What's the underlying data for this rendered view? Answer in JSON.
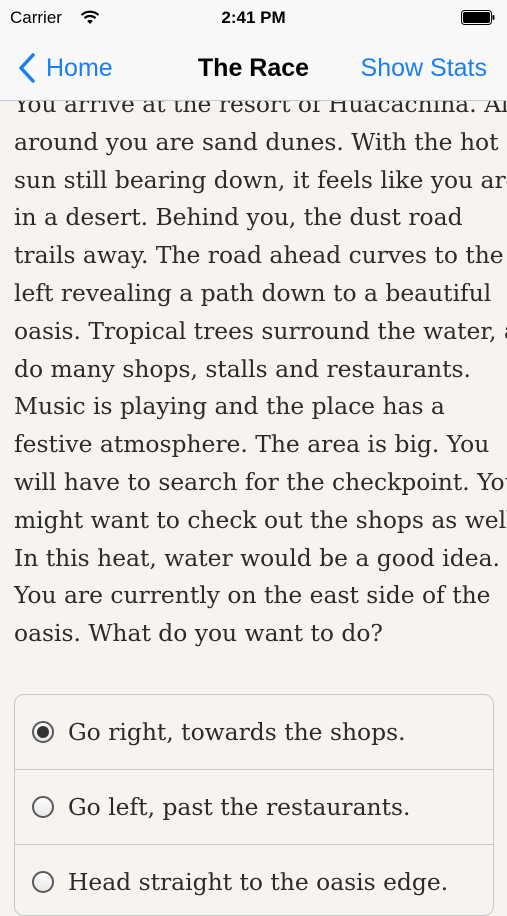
{
  "status_bar": {
    "carrier": "Carrier",
    "time": "2:41 PM",
    "icons": [
      "wifi-icon",
      "battery-icon"
    ]
  },
  "nav": {
    "back_label": "Home",
    "title": "The Race",
    "right_button": "Show Stats",
    "accent_color": "#1a7ef3"
  },
  "story": {
    "lines": [
      "You arrive at the resort of Huacachina. All",
      "around you are sand dunes. With the hot",
      "sun still bearing down, it feels like you are",
      "in a desert. Behind you, the dust road",
      "trails away. The road ahead curves to the",
      "left revealing a path down to a beautiful",
      "oasis. Tropical trees surround the water, as",
      "do many shops, stalls and restaurants.",
      "Music is playing and the place has a",
      "festive atmosphere. The area is big. You",
      "will have to search for the checkpoint. You",
      "might want to check out the shops as well.",
      "In this heat, water would be a good idea.",
      "You are currently on the east side of the",
      "oasis. What do you want to do?"
    ]
  },
  "choices": [
    {
      "label": "Go right, towards the shops.",
      "selected": true
    },
    {
      "label": "Go left, past the restaurants.",
      "selected": false
    },
    {
      "label": "Head straight to the oasis edge.",
      "selected": false
    }
  ]
}
